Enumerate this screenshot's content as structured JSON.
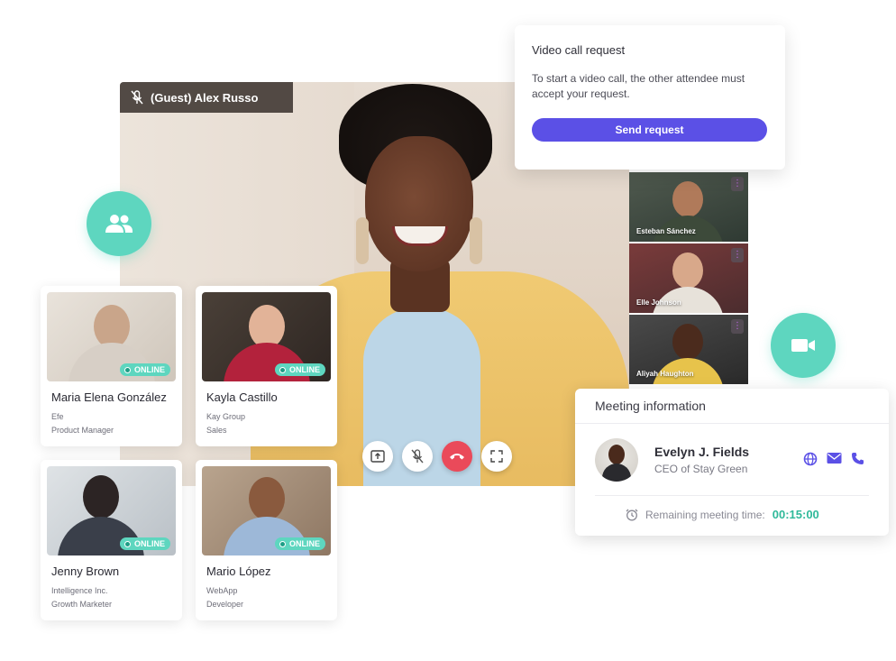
{
  "main_video": {
    "guest_label": "(Guest) Alex Russo"
  },
  "thumbnails": [
    {
      "name": "Esteban Sánchez"
    },
    {
      "name": "Elle Johnson"
    },
    {
      "name": "Aliyah Haughton"
    }
  ],
  "call_request": {
    "title": "Video call request",
    "text": "To start a video call, the other attendee must accept your request.",
    "button": "Send request"
  },
  "contacts": [
    {
      "name": "Maria Elena González",
      "company": "Efe",
      "role": "Product Manager",
      "status": "ONLINE"
    },
    {
      "name": "Kayla Castillo",
      "company": "Kay Group",
      "role": "Sales",
      "status": "ONLINE"
    },
    {
      "name": "Jenny Brown",
      "company": "Intelligence Inc.",
      "role": "Growth Marketer",
      "status": "ONLINE"
    },
    {
      "name": "Mario López",
      "company": "WebApp",
      "role": "Developer",
      "status": "ONLINE"
    }
  ],
  "meeting": {
    "title": "Meeting information",
    "host_name": "Evelyn J. Fields",
    "host_role": "CEO of Stay Green",
    "remaining_label": "Remaining meeting time:",
    "remaining_value": "00:15:00"
  },
  "colors": {
    "accent_purple": "#5b50e6",
    "accent_teal": "#5ed6bf",
    "hangup_red": "#ea4a5a",
    "timer_green": "#2fb99a"
  },
  "icons": {
    "people": "people-icon",
    "video": "video-camera-icon",
    "mic_off": "mic-off-icon",
    "share": "share-screen-icon",
    "hangup": "hang-up-icon",
    "fullscreen": "fullscreen-icon",
    "globe": "globe-icon",
    "mail": "mail-icon",
    "phone": "phone-icon",
    "alarm": "alarm-clock-icon"
  }
}
